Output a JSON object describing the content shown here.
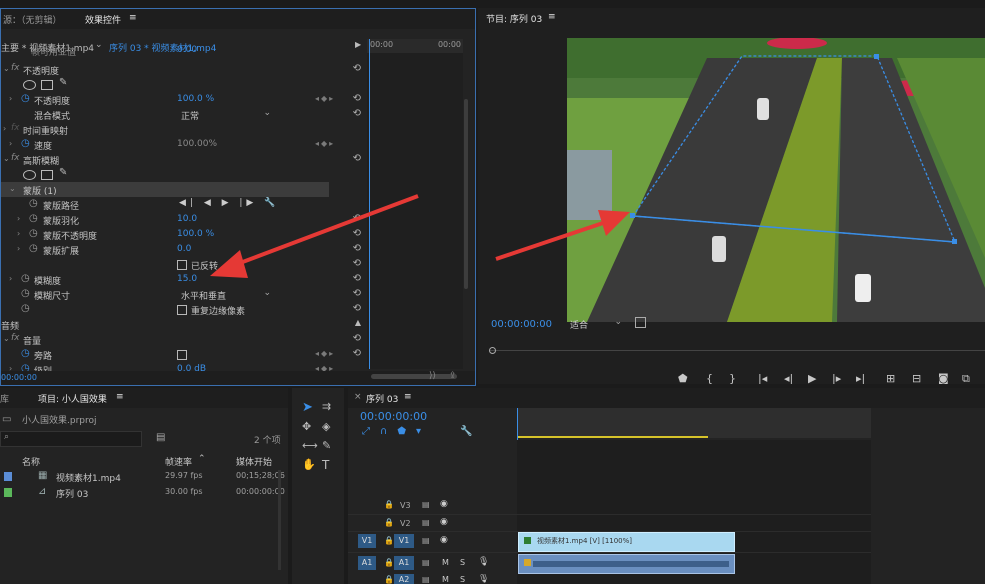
{
  "source_tab": "源：（无剪辑）",
  "effect_controls_tab": "效果控件",
  "clip_path": "主要 * 视频素材1.mp4",
  "clip_seq": "序列 03 * 视频素材1.mp4",
  "ec_time_start": "00:00",
  "ec_time_end": "00:00",
  "partial_top_row": "帧可用亚值",
  "partial_top_val": "0.00",
  "opacity_group": "不透明度",
  "opacity_label": "不透明度",
  "opacity_value": "100.0 %",
  "blend_mode_label": "混合模式",
  "blend_mode_value": "正常",
  "time_remap": "时间重映射",
  "speed_label": "速度",
  "speed_value": "100.00%",
  "gaussian_blur": "高斯模糊",
  "mask_label": "蒙版 (1)",
  "mask_path": "蒙版路径",
  "mask_feather": "蒙版羽化",
  "mask_feather_val": "10.0",
  "mask_opacity": "蒙版不透明度",
  "mask_opacity_val": "100.0 %",
  "mask_expand": "蒙版扩展",
  "mask_expand_val": "0.0",
  "inverted": "已反转",
  "blurriness_label": "模糊度",
  "blurriness_value": "15.0",
  "blur_dim_label": "模糊尺寸",
  "blur_dim_value": "水平和垂直",
  "repeat_edge": "重复边缘像素",
  "audio_section": "音频",
  "volume": "音量",
  "bypass": "旁路",
  "level": "级别",
  "level_val": "0.0 dB",
  "ec_bottom_time": "00:00:00",
  "program_title": "节目: 序列 03",
  "program_time": "00:00:00:00",
  "fit_label": "适合",
  "project_tab": "项目: 小人国效果",
  "lib_tab": "库",
  "project_file": "小人国效果.prproj",
  "item_count": "2 个项",
  "col_name": "名称",
  "col_fps": "帧速率",
  "col_start": "媒体开始",
  "items": [
    {
      "name": "视频素材1.mp4",
      "fps": "29.97 fps",
      "start": "00;15;28;06",
      "color": "#5b8dd6"
    },
    {
      "name": "序列 03",
      "fps": "30.00 fps",
      "start": "00:00:00:00",
      "color": "#5bb85b"
    }
  ],
  "timeline_tab": "序列 03",
  "timeline_time": "00:00:00:00",
  "tracks": [
    {
      "name": "V3",
      "patch": ""
    },
    {
      "name": "V2",
      "patch": ""
    },
    {
      "name": "V1",
      "patch": "V1"
    },
    {
      "name": "A1",
      "patch": "A1"
    },
    {
      "name": "A2",
      "patch": ""
    }
  ],
  "clip_label": "视频素材1.mp4 [V] [1100%]",
  "accent": "#3a8ee6",
  "arrow_color": "#e53935"
}
